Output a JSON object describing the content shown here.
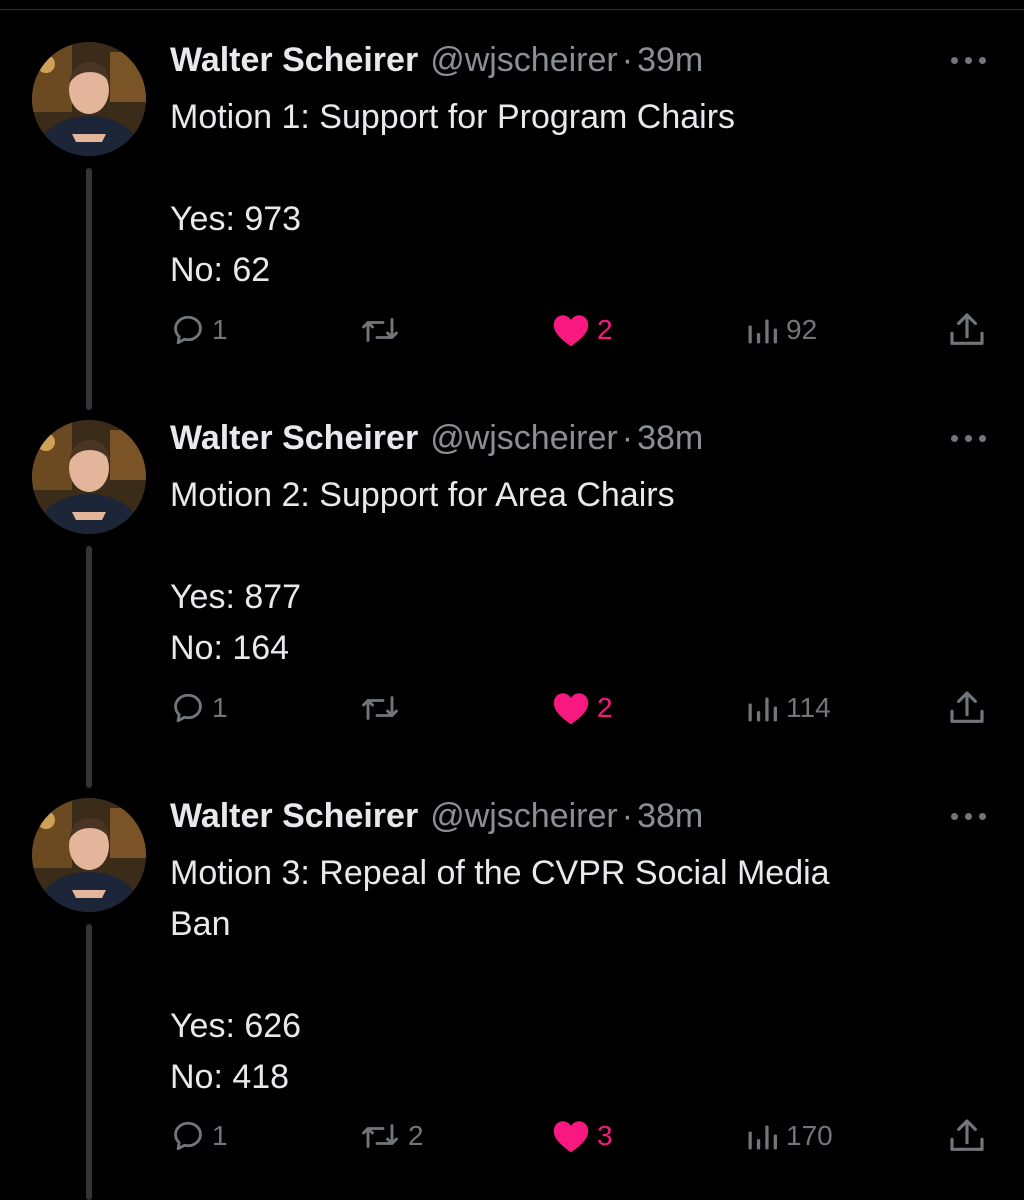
{
  "colors": {
    "background": "#000000",
    "text": "#e7e9ea",
    "muted": "#71767b",
    "like": "#f91880"
  },
  "icons": {
    "reply": "speech-bubble-icon",
    "repost": "repost-arrows-icon",
    "like": "heart-icon",
    "views": "bar-chart-icon",
    "share": "share-upload-icon",
    "more": "more-dots-icon"
  },
  "tweets": [
    {
      "author_name": "Walter Scheirer",
      "handle": "@wjscheirer",
      "separator": "·",
      "time": "39m",
      "text_lines": [
        "Motion 1: Support for Program Chairs"
      ],
      "result_lines": [
        "Yes: 973",
        "No: 62"
      ],
      "replies": "1",
      "reposts": "",
      "likes": "2",
      "views": "92"
    },
    {
      "author_name": "Walter Scheirer",
      "handle": "@wjscheirer",
      "separator": "·",
      "time": "38m",
      "text_lines": [
        "Motion 2: Support for Area Chairs"
      ],
      "result_lines": [
        "Yes: 877",
        "No: 164"
      ],
      "replies": "1",
      "reposts": "",
      "likes": "2",
      "views": "114"
    },
    {
      "author_name": "Walter Scheirer",
      "handle": "@wjscheirer",
      "separator": "·",
      "time": "38m",
      "text_lines": [
        "Motion 3: Repeal of the CVPR Social Media",
        "Ban"
      ],
      "result_lines": [
        "Yes: 626",
        "No: 418"
      ],
      "replies": "1",
      "reposts": "2",
      "likes": "3",
      "views": "170"
    }
  ]
}
